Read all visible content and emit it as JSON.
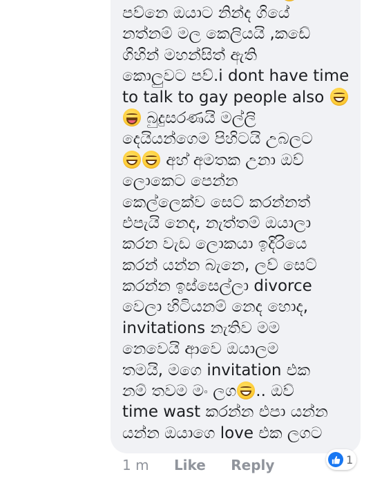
{
  "comment": {
    "lines": [
      "පව්නෙ ඔයාට නින්ද ගියේ",
      "නත්නම් මල කෙලියයි ,කඩේ",
      "ගිහින් මහන්සිත් ඇති",
      "කොලුවට පව්.i dont have time",
      "to talk to gay people also",
      " බුදුසරණයි මල්ලි",
      "දෙයියන්ගෙම පිහිටයි උබලට",
      " අහ් අමතක උනා ඔව්",
      "ලොකෙට පෙන්න",
      "කෙල්ලෙක්ව සෙට් කරන්නත්",
      "එපැයි නෙද, නැත්තම් ඔයාලා",
      "කරන වැඩ ලොකයා ඉදිරියෙ",
      "කරන් යන්න බැනෙ, ලව් සෙට්",
      "කරන්න ඉස්සෙල්ලා divorce",
      "වෙලා හිටියනම් නෙද හොද,",
      "invitations නැතිව මම",
      "නෙවෙයි ආවෙ ඔයාලම",
      "තමයි, මගෙ invitation එක",
      "නම් තවම මං ලග",
      ".. ඔව්",
      "time wast කරන්න එපා යන්න",
      "යන්න ඔයාගෙ love එක ලගට"
    ],
    "emoji": {
      "laughing": "laughing-emoji",
      "winking_tongue": "winking-tongue-emoji"
    }
  },
  "meta": {
    "time": "1 m",
    "like_label": "Like",
    "reply_label": "Reply"
  },
  "reactions": {
    "icon": "like-icon",
    "count": "1",
    "color": "#1877f2"
  },
  "colors": {
    "bubble": "#f1f2f5",
    "text": "#1c1e21",
    "meta": "#90949c"
  }
}
